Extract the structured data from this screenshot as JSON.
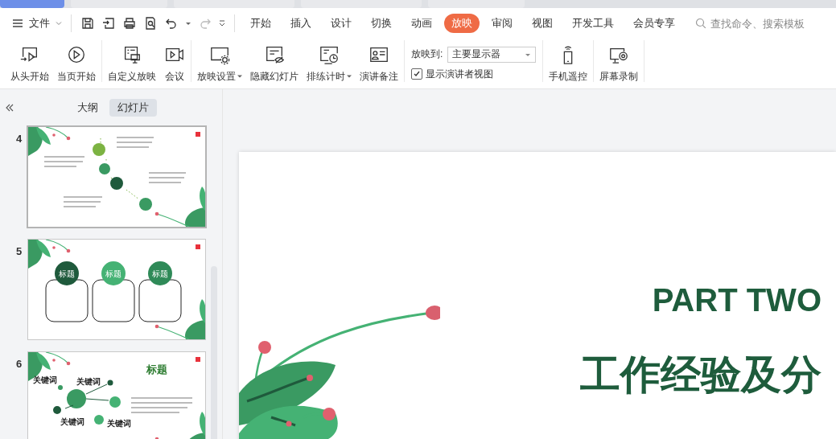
{
  "file_menu": {
    "label": "文件"
  },
  "ribbon_tabs": [
    {
      "label": "开始",
      "selected": false
    },
    {
      "label": "插入",
      "selected": false
    },
    {
      "label": "设计",
      "selected": false
    },
    {
      "label": "切换",
      "selected": false
    },
    {
      "label": "动画",
      "selected": false
    },
    {
      "label": "放映",
      "selected": true
    },
    {
      "label": "审阅",
      "selected": false
    },
    {
      "label": "视图",
      "selected": false
    },
    {
      "label": "开发工具",
      "selected": false
    },
    {
      "label": "会员专享",
      "selected": false
    }
  ],
  "search": {
    "placeholder": "查找命令、搜索模板"
  },
  "ribbon_groups": [
    {
      "items": [
        {
          "kind": "button",
          "label": "从头开始",
          "has_menu": false
        },
        {
          "kind": "button",
          "label": "当页开始",
          "has_menu": false
        }
      ]
    },
    {
      "items": [
        {
          "kind": "button",
          "label": "自定义放映",
          "has_menu": false
        },
        {
          "kind": "button",
          "label": "会议",
          "has_menu": false
        }
      ]
    },
    {
      "items": [
        {
          "kind": "button",
          "label": "放映设置",
          "has_menu": true
        },
        {
          "kind": "button",
          "label": "隐藏幻灯片",
          "has_menu": false
        },
        {
          "kind": "button",
          "label": "排练计时",
          "has_menu": true
        },
        {
          "kind": "button",
          "label": "演讲备注",
          "has_menu": false
        }
      ]
    },
    {
      "items": [
        {
          "kind": "display",
          "label": "放映到:",
          "value": "主要显示器",
          "checkbox": {
            "label": "显示演讲者视图",
            "checked": true
          }
        }
      ]
    },
    {
      "items": [
        {
          "kind": "button",
          "label": "手机遥控",
          "has_menu": false
        }
      ]
    },
    {
      "items": [
        {
          "kind": "button",
          "label": "屏幕录制",
          "has_menu": false
        }
      ]
    }
  ],
  "panel_tabs": [
    {
      "label": "大纲",
      "selected": false
    },
    {
      "label": "幻灯片",
      "selected": true
    }
  ],
  "slides": [
    {
      "number": "4",
      "selected": true,
      "kind": "timeline"
    },
    {
      "number": "5",
      "selected": false,
      "kind": "cards",
      "labels": [
        "标题",
        "标题",
        "标题"
      ]
    },
    {
      "number": "6",
      "selected": false,
      "kind": "mindmap",
      "title": "标题",
      "labels": [
        "关键词",
        "关键词",
        "关键词",
        "关键词"
      ]
    }
  ],
  "current_slide": {
    "heading": "PART TWO",
    "title": "工作经验及分"
  }
}
